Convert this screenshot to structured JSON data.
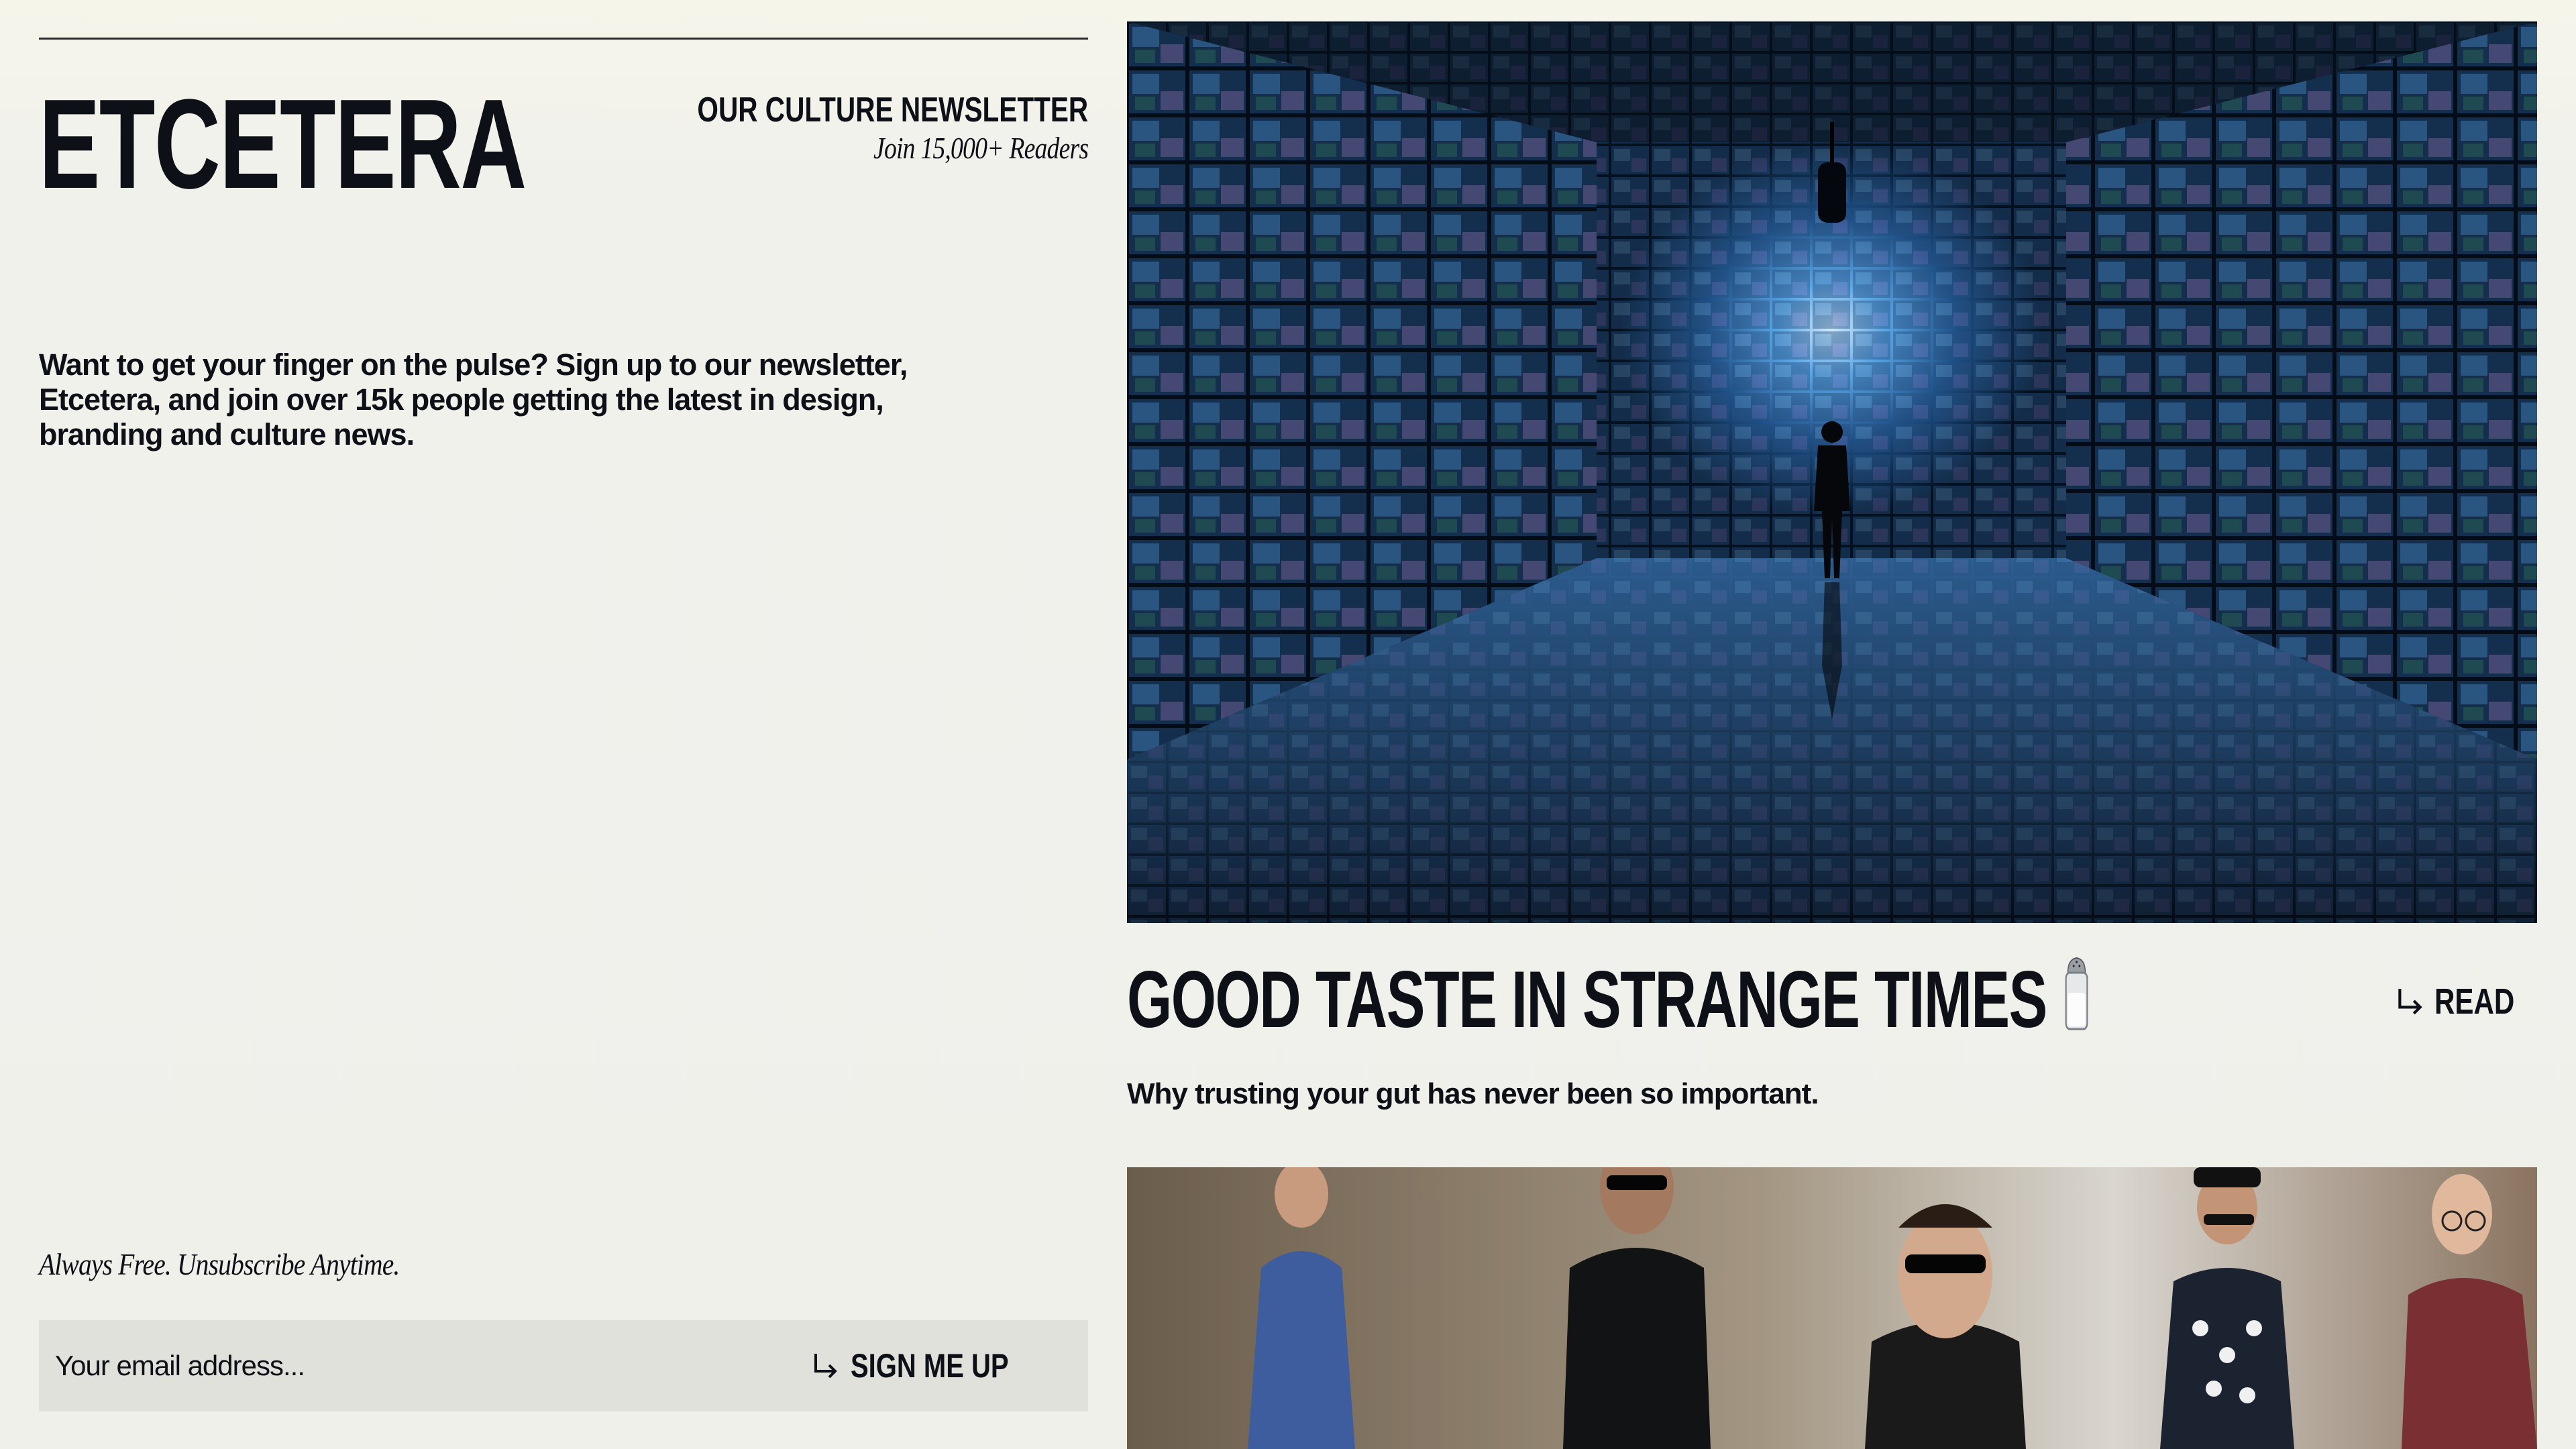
{
  "brand": {
    "title": "ETCETERA"
  },
  "newsletter": {
    "label": "OUR CULTURE NEWSLETTER",
    "readers": "Join 15,000+ Readers"
  },
  "intro": {
    "text": "Want to get your finger on the pulse? Sign up to our newsletter, Etcetera, and join over 15k people getting the latest in design, branding and culture news."
  },
  "signup": {
    "tagline": "Always Free. Unsubscribe Anytime.",
    "email_placeholder": "Your email address...",
    "button_label": "SIGN ME UP",
    "button_icon": "arrow-return-right-icon"
  },
  "article": {
    "title": "GOOD TASTE IN STRANGE TIMES",
    "title_icon": "salt-shaker-icon",
    "subtitle": "Why trusting your gut has never been so important.",
    "read_label": "READ",
    "read_icon": "arrow-return-right-icon",
    "image_description_icon": "screen-corridor-image"
  },
  "second_article": {
    "image_icon": "fashion-street-image"
  },
  "colors": {
    "background": "#f0f0eb",
    "text": "#0d1117",
    "input_background": "#e1e1dc"
  }
}
